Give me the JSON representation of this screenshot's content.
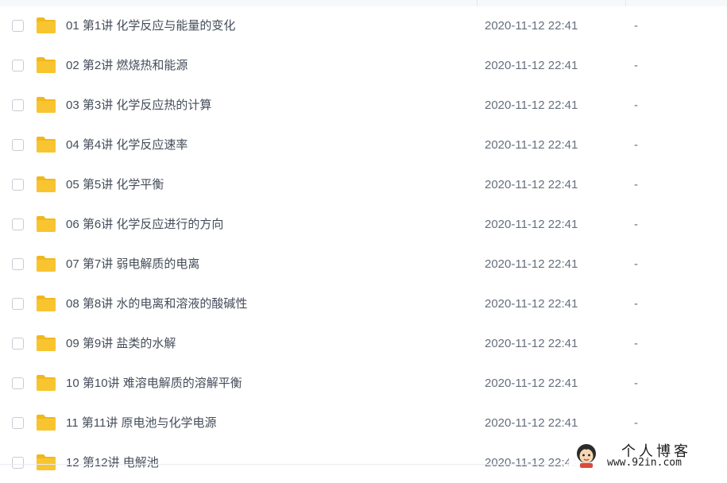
{
  "columns": {
    "date_header": "",
    "size_header": ""
  },
  "files": [
    {
      "name": "01 第1讲 化学反应与能量的变化",
      "date": "2020-11-12 22:41",
      "size": "-"
    },
    {
      "name": "02 第2讲 燃烧热和能源",
      "date": "2020-11-12 22:41",
      "size": "-"
    },
    {
      "name": "03 第3讲 化学反应热的计算",
      "date": "2020-11-12 22:41",
      "size": "-"
    },
    {
      "name": "04 第4讲 化学反应速率",
      "date": "2020-11-12 22:41",
      "size": "-"
    },
    {
      "name": "05 第5讲 化学平衡",
      "date": "2020-11-12 22:41",
      "size": "-"
    },
    {
      "name": "06 第6讲 化学反应进行的方向",
      "date": "2020-11-12 22:41",
      "size": "-"
    },
    {
      "name": "07 第7讲 弱电解质的电离",
      "date": "2020-11-12 22:41",
      "size": "-"
    },
    {
      "name": "08 第8讲 水的电离和溶液的酸碱性",
      "date": "2020-11-12 22:41",
      "size": "-"
    },
    {
      "name": "09 第9讲 盐类的水解",
      "date": "2020-11-12 22:41",
      "size": "-"
    },
    {
      "name": "10 第10讲 难溶电解质的溶解平衡",
      "date": "2020-11-12 22:41",
      "size": "-"
    },
    {
      "name": "11 第11讲 原电池与化学电源",
      "date": "2020-11-12 22:41",
      "size": "-"
    },
    {
      "name": "12 第12讲 电解池",
      "date": "2020-11-12 22:41",
      "size": "-"
    }
  ],
  "icons": {
    "folder": "folder-icon",
    "checkbox": "checkbox-icon"
  },
  "colors": {
    "folder": "#f8c530",
    "folder_tab": "#f0b81c",
    "text": "#454d5a",
    "meta": "#666f7d"
  },
  "watermark": {
    "title": "个人博客",
    "url": "www.92in.com"
  }
}
